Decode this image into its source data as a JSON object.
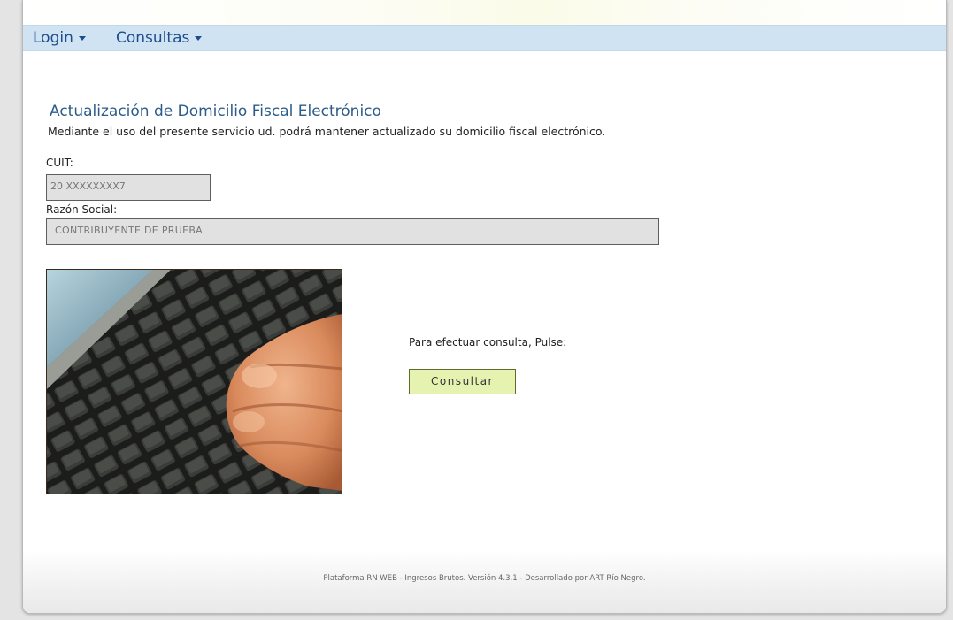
{
  "nav": {
    "items": [
      {
        "label": "Login"
      },
      {
        "label": "Consultas"
      }
    ]
  },
  "page": {
    "title": "Actualización de Domicilio Fiscal Electrónico",
    "subtitle": "Mediante el uso del presente servicio ud. podrá mantener actualizado su domicilio fiscal electrónico."
  },
  "form": {
    "cuit_label": "CUIT:",
    "cuit_value": "20 XXXXXXXX7",
    "razon_label": "Razón Social:",
    "razon_value": "CONTRIBUYENTE DE PRUEBA"
  },
  "action": {
    "hint": "Para efectuar consulta, Pulse:",
    "button_label": "Consultar"
  },
  "footer": {
    "text": "Plataforma RN WEB - Ingresos Brutos. Versión 4.3.1 - Desarrollado por ART Río Negro."
  },
  "colors": {
    "nav_bg": "#cfe3f3",
    "nav_text": "#1f4d8c",
    "title": "#2c5c8a",
    "button_bg": "#e6f2b0"
  }
}
